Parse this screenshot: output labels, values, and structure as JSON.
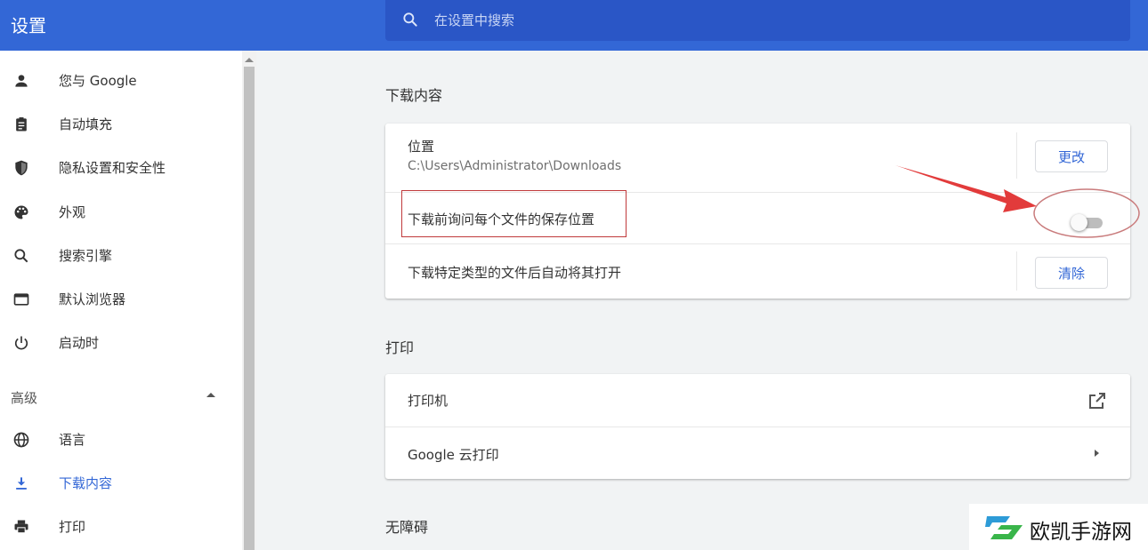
{
  "header": {
    "title": "设置",
    "search_placeholder": "在设置中搜索"
  },
  "sidebar": {
    "items": [
      {
        "label": "您与 Google",
        "icon": "person-icon"
      },
      {
        "label": "自动填充",
        "icon": "clipboard-icon"
      },
      {
        "label": "隐私设置和安全性",
        "icon": "shield-icon"
      },
      {
        "label": "外观",
        "icon": "palette-icon"
      },
      {
        "label": "搜索引擎",
        "icon": "search-icon"
      },
      {
        "label": "默认浏览器",
        "icon": "browser-window-icon"
      },
      {
        "label": "启动时",
        "icon": "power-icon"
      }
    ],
    "advanced_label": "高级",
    "advanced_items": [
      {
        "label": "语言",
        "icon": "globe-icon"
      },
      {
        "label": "下载内容",
        "icon": "download-icon",
        "active": true
      },
      {
        "label": "打印",
        "icon": "printer-icon"
      }
    ]
  },
  "downloads": {
    "section_title": "下载内容",
    "location_label": "位置",
    "location_path": "C:\\Users\\Administrator\\Downloads",
    "change_button": "更改",
    "ask_where_label": "下载前询问每个文件的保存位置",
    "ask_where_enabled": false,
    "auto_open_label": "下载特定类型的文件后自动将其打开",
    "clear_button": "清除"
  },
  "printing": {
    "section_title": "打印",
    "printers_label": "打印机",
    "cloud_print_label": "Google 云打印"
  },
  "accessibility": {
    "section_title": "无障碍"
  },
  "watermark": {
    "text": "欧凯手游网"
  },
  "colors": {
    "header": "#3367d6",
    "search": "#2a56c6",
    "annotation": "#d2383a"
  }
}
